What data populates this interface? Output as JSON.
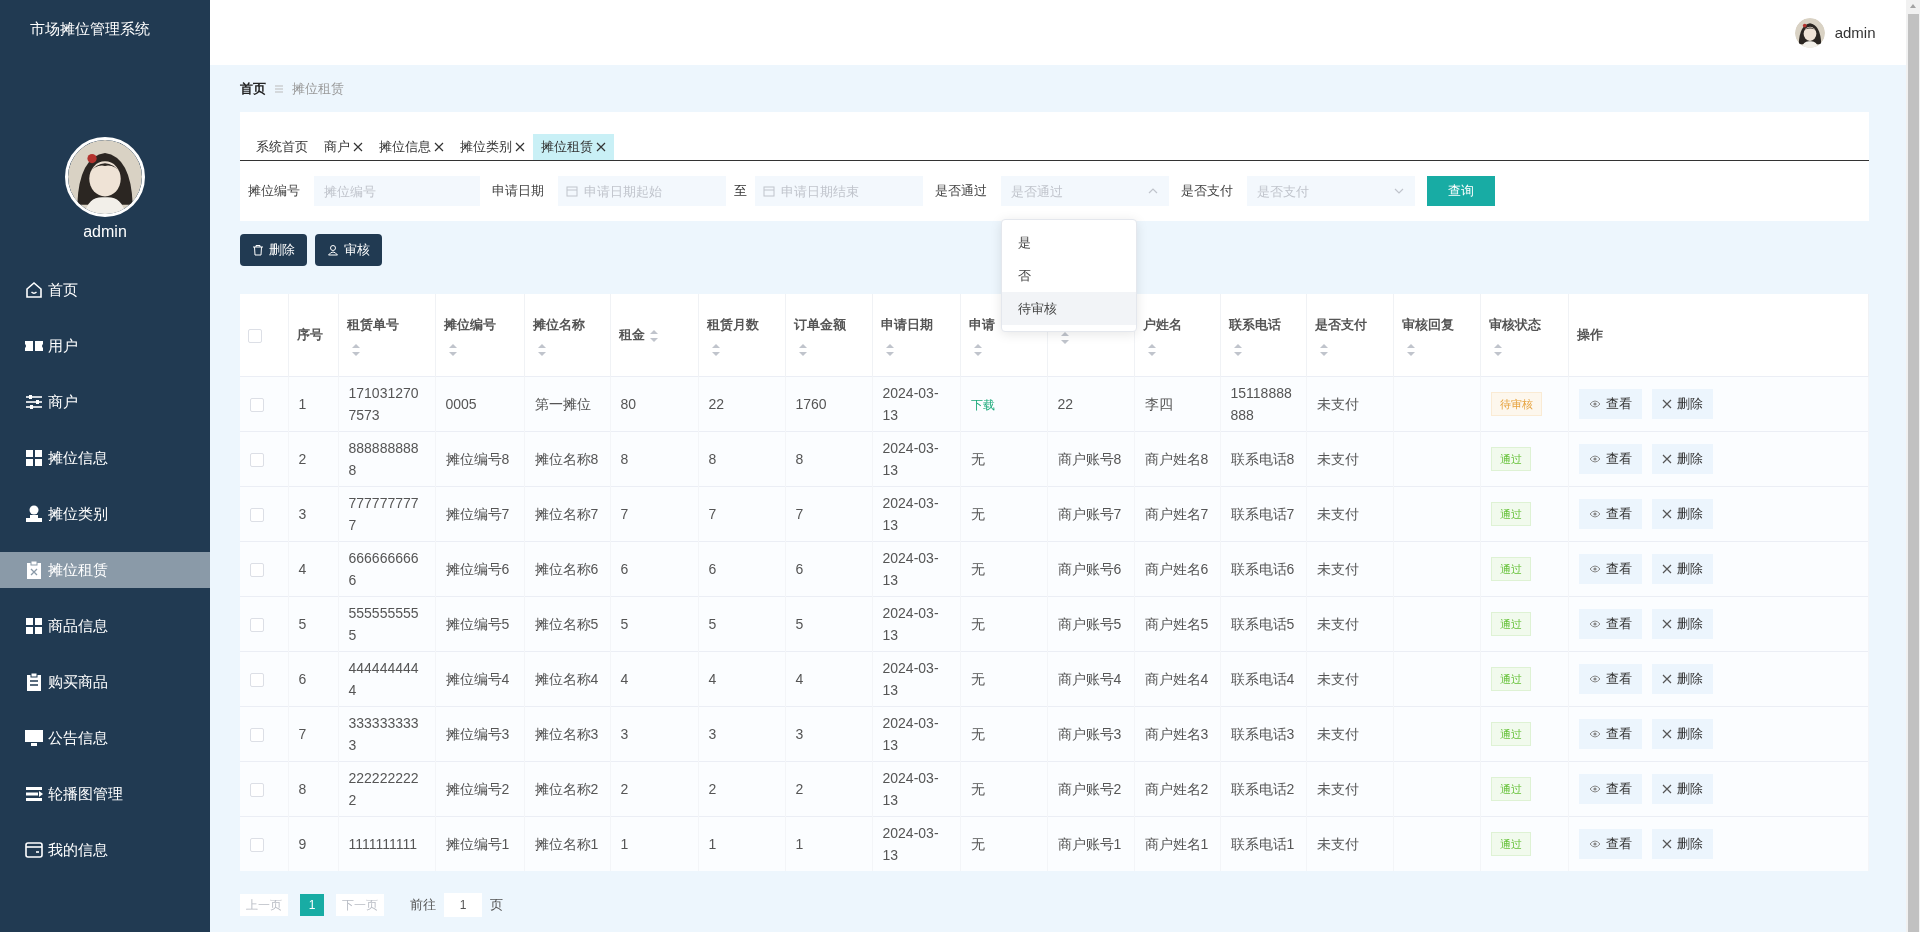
{
  "sidebar": {
    "title": "市场摊位管理系统",
    "user": "admin",
    "items": [
      {
        "label": "首页",
        "selected": false
      },
      {
        "label": "用户",
        "selected": false
      },
      {
        "label": "商户",
        "selected": false
      },
      {
        "label": "摊位信息",
        "selected": false
      },
      {
        "label": "摊位类别",
        "selected": false
      },
      {
        "label": "摊位租赁",
        "selected": true
      },
      {
        "label": "商品信息",
        "selected": false
      },
      {
        "label": "购买商品",
        "selected": false
      },
      {
        "label": "公告信息",
        "selected": false
      },
      {
        "label": "轮播图管理",
        "selected": false
      },
      {
        "label": "我的信息",
        "selected": false
      }
    ]
  },
  "header": {
    "user": "admin"
  },
  "breadcrumb": [
    "首页",
    "摊位租赁"
  ],
  "tabs": [
    {
      "label": "系统首页",
      "closable": false,
      "selected": false
    },
    {
      "label": "商户",
      "closable": true,
      "selected": false
    },
    {
      "label": "摊位信息",
      "closable": true,
      "selected": false
    },
    {
      "label": "摊位类别",
      "closable": true,
      "selected": false
    },
    {
      "label": "摊位租赁",
      "closable": true,
      "selected": true
    }
  ],
  "filters": [
    {
      "kind": "text",
      "label": "摊位编号",
      "placeholder": "摊位编号"
    },
    {
      "kind": "daterange",
      "label": "申请日期",
      "start_placeholder": "申请日期起始",
      "separator": "至",
      "end_placeholder": "申请日期结束"
    },
    {
      "kind": "select",
      "label": "是否通过",
      "placeholder": "是否通过",
      "expanded": true
    },
    {
      "kind": "select",
      "label": "是否支付",
      "placeholder": "是否支付",
      "expanded": false
    }
  ],
  "search_button": "查询",
  "dropdown": {
    "options": [
      {
        "label": "是",
        "hovered": false
      },
      {
        "label": "否",
        "hovered": false
      },
      {
        "label": "待审核",
        "hovered": true
      }
    ]
  },
  "actions": [
    {
      "label": "删除",
      "kind": "delete"
    },
    {
      "label": "审核",
      "kind": "review"
    }
  ],
  "table": {
    "columns": [
      {
        "kind": "checkbox",
        "checked": false
      },
      {
        "kind": "text",
        "label": "序号",
        "sortable": false
      },
      {
        "kind": "text",
        "label": "租赁单号",
        "sortable": true
      },
      {
        "kind": "text",
        "label": "摊位编号",
        "sortable": true
      },
      {
        "kind": "text",
        "label": "摊位名称",
        "sortable": true
      },
      {
        "kind": "text",
        "label": "租金",
        "sortable": true
      },
      {
        "kind": "text",
        "label": "租赁月数",
        "sortable": true
      },
      {
        "kind": "text",
        "label": "订单金额",
        "sortable": true
      },
      {
        "kind": "text",
        "label": "申请日期",
        "sortable": true
      },
      {
        "kind": "text",
        "label": "申请",
        "sortable": true
      },
      {
        "kind": "text",
        "sortable": true
      },
      {
        "kind": "text",
        "label": "户姓名",
        "sortable": true
      },
      {
        "kind": "text",
        "label": "联系电话",
        "sortable": true
      },
      {
        "kind": "text",
        "label": "是否支付",
        "sortable": true
      },
      {
        "kind": "text",
        "label": "审核回复",
        "sortable": true
      },
      {
        "kind": "text",
        "label": "审核状态",
        "sortable": true
      },
      {
        "kind": "text",
        "label": "操作",
        "sortable": false
      }
    ],
    "rows": [
      {
        "cells": [
          {
            "kind": "checkbox",
            "checked": false
          },
          "1",
          "1710312707573",
          "0005",
          "第一摊位",
          "80",
          "22",
          "1760",
          "2024-03-13",
          {
            "kind": "link",
            "text": "下载"
          },
          "22",
          "李四",
          "15118888888",
          "未支付",
          null,
          {
            "kind": "tag",
            "color": "#e6a23c",
            "text": "待审核"
          },
          {
            "kind": "actions",
            "buttons": [
              {
                "kind": "view",
                "label": "查看"
              },
              {
                "kind": "delete",
                "label": "删除"
              }
            ]
          }
        ]
      },
      {
        "cells": [
          {
            "kind": "checkbox",
            "checked": false
          },
          "2",
          "8888888888",
          "摊位编号8",
          "摊位名称8",
          "8",
          "8",
          "8",
          "2024-03-13",
          "无",
          "商户账号8",
          "商户姓名8",
          "联系电话8",
          "未支付",
          null,
          {
            "kind": "tag",
            "color": "#67c23a",
            "text": "通过"
          },
          {
            "kind": "actions",
            "buttons": [
              {
                "kind": "view",
                "label": "查看"
              },
              {
                "kind": "delete",
                "label": "删除"
              }
            ]
          }
        ]
      },
      {
        "cells": [
          {
            "kind": "checkbox",
            "checked": false
          },
          "3",
          "7777777777",
          "摊位编号7",
          "摊位名称7",
          "7",
          "7",
          "7",
          "2024-03-13",
          "无",
          "商户账号7",
          "商户姓名7",
          "联系电话7",
          "未支付",
          null,
          {
            "kind": "tag",
            "color": "#67c23a",
            "text": "通过"
          },
          {
            "kind": "actions",
            "buttons": [
              {
                "kind": "view",
                "label": "查看"
              },
              {
                "kind": "delete",
                "label": "删除"
              }
            ]
          }
        ]
      },
      {
        "cells": [
          {
            "kind": "checkbox",
            "checked": false
          },
          "4",
          "6666666666",
          "摊位编号6",
          "摊位名称6",
          "6",
          "6",
          "6",
          "2024-03-13",
          "无",
          "商户账号6",
          "商户姓名6",
          "联系电话6",
          "未支付",
          null,
          {
            "kind": "tag",
            "color": "#67c23a",
            "text": "通过"
          },
          {
            "kind": "actions",
            "buttons": [
              {
                "kind": "view",
                "label": "查看"
              },
              {
                "kind": "delete",
                "label": "删除"
              }
            ]
          }
        ]
      },
      {
        "cells": [
          {
            "kind": "checkbox",
            "checked": false
          },
          "5",
          "5555555555",
          "摊位编号5",
          "摊位名称5",
          "5",
          "5",
          "5",
          "2024-03-13",
          "无",
          "商户账号5",
          "商户姓名5",
          "联系电话5",
          "未支付",
          null,
          {
            "kind": "tag",
            "color": "#67c23a",
            "text": "通过"
          },
          {
            "kind": "actions",
            "buttons": [
              {
                "kind": "view",
                "label": "查看"
              },
              {
                "kind": "delete",
                "label": "删除"
              }
            ]
          }
        ]
      },
      {
        "cells": [
          {
            "kind": "checkbox",
            "checked": false
          },
          "6",
          "4444444444",
          "摊位编号4",
          "摊位名称4",
          "4",
          "4",
          "4",
          "2024-03-13",
          "无",
          "商户账号4",
          "商户姓名4",
          "联系电话4",
          "未支付",
          null,
          {
            "kind": "tag",
            "color": "#67c23a",
            "text": "通过"
          },
          {
            "kind": "actions",
            "buttons": [
              {
                "kind": "view",
                "label": "查看"
              },
              {
                "kind": "delete",
                "label": "删除"
              }
            ]
          }
        ]
      },
      {
        "cells": [
          {
            "kind": "checkbox",
            "checked": false
          },
          "7",
          "3333333333",
          "摊位编号3",
          "摊位名称3",
          "3",
          "3",
          "3",
          "2024-03-13",
          "无",
          "商户账号3",
          "商户姓名3",
          "联系电话3",
          "未支付",
          null,
          {
            "kind": "tag",
            "color": "#67c23a",
            "text": "通过"
          },
          {
            "kind": "actions",
            "buttons": [
              {
                "kind": "view",
                "label": "查看"
              },
              {
                "kind": "delete",
                "label": "删除"
              }
            ]
          }
        ]
      },
      {
        "cells": [
          {
            "kind": "checkbox",
            "checked": false
          },
          "8",
          "2222222222",
          "摊位编号2",
          "摊位名称2",
          "2",
          "2",
          "2",
          "2024-03-13",
          "无",
          "商户账号2",
          "商户姓名2",
          "联系电话2",
          "未支付",
          null,
          {
            "kind": "tag",
            "color": "#67c23a",
            "text": "通过"
          },
          {
            "kind": "actions",
            "buttons": [
              {
                "kind": "view",
                "label": "查看"
              },
              {
                "kind": "delete",
                "label": "删除"
              }
            ]
          }
        ]
      },
      {
        "cells": [
          {
            "kind": "checkbox",
            "checked": false
          },
          "9",
          "1111111111",
          "摊位编号1",
          "摊位名称1",
          "1",
          "1",
          "1",
          "2024-03-13",
          "无",
          "商户账号1",
          "商户姓名1",
          "联系电话1",
          "未支付",
          null,
          {
            "kind": "tag",
            "color": "#67c23a",
            "text": "通过"
          },
          {
            "kind": "actions",
            "buttons": [
              {
                "kind": "view",
                "label": "查看"
              },
              {
                "kind": "delete",
                "label": "删除"
              }
            ]
          }
        ]
      }
    ]
  },
  "pagination": {
    "prev": {
      "label": "上一页",
      "disabled": true
    },
    "pages": [
      {
        "label": "1",
        "selected": true
      }
    ],
    "next": {
      "label": "下一页",
      "disabled": true
    },
    "goto_label": "前往",
    "goto_value": "1",
    "goto_suffix": "页"
  }
}
